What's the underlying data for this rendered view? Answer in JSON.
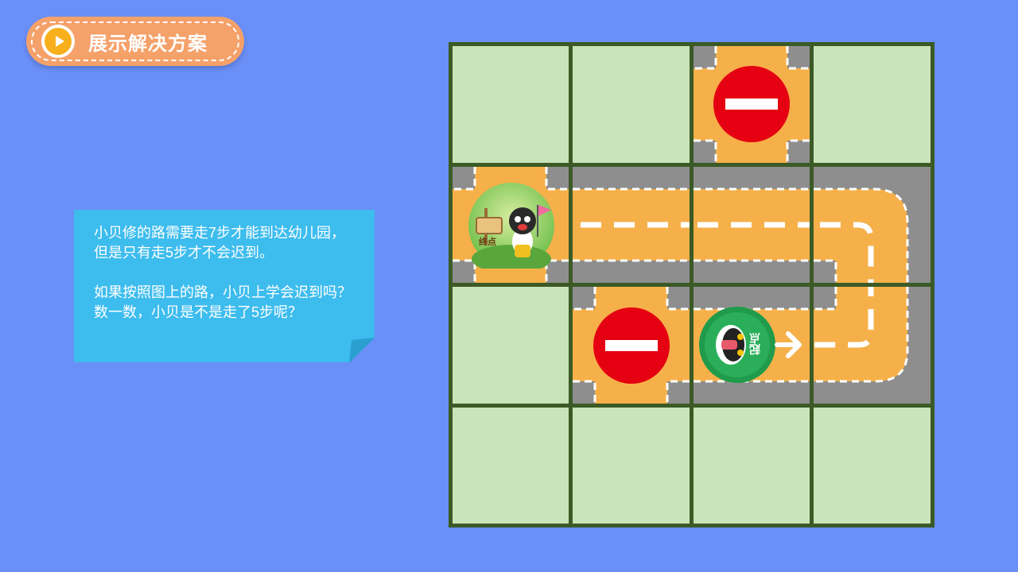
{
  "header": {
    "solution_button_label": "展示解决方案"
  },
  "note": {
    "paragraph1": "小贝修的路需要走7步才能到达幼儿园，但是只有走5步才不会迟到。",
    "paragraph2": "如果按照图上的路，小贝上学会迟到吗？数一数，小贝是不是走了5步呢？"
  },
  "board": {
    "finish_label": "终点",
    "start_label": "起点",
    "colors": {
      "road": "#f6b04a",
      "asphalt": "#8e8e8e",
      "grass": "#c9e4b9",
      "grid_line": "#3b5a26",
      "no_entry": "#e50012"
    }
  }
}
